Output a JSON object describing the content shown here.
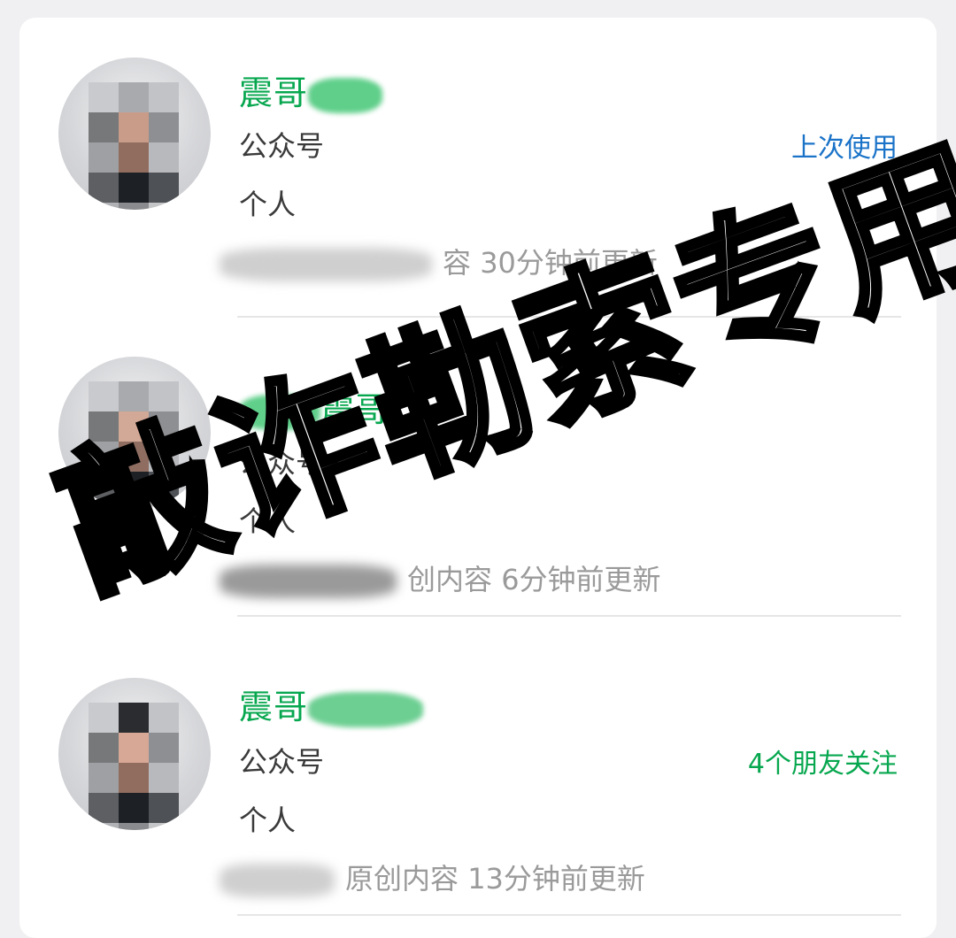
{
  "results": [
    {
      "name": "震哥",
      "type": "公众号",
      "subtype": "个人",
      "update_snippet": "容",
      "update_time": "30分钟前更新",
      "tag": "上次使用",
      "tag_color": "#1a73c8"
    },
    {
      "name": "震哥",
      "type": "公众号",
      "subtype": "个人",
      "update_snippet": "创内容",
      "update_time": "6分钟前更新",
      "tag": "",
      "tag_color": ""
    },
    {
      "name": "震哥",
      "type": "公众号",
      "subtype": "个人",
      "update_snippet": "原创内容",
      "update_time": "13分钟前更新",
      "tag": "4个朋友关注",
      "tag_color": "#07a74f"
    }
  ],
  "watermark": "敲诈勒索专用号",
  "colors": {
    "name_green": "#07a74f",
    "link_blue": "#1a73c8",
    "meta_gray": "#9a9a9a",
    "card_bg": "#ffffff",
    "page_bg": "#f0f0f2"
  },
  "icons": [
    "blurred-avatar",
    "blurred-avatar",
    "blurred-avatar"
  ]
}
